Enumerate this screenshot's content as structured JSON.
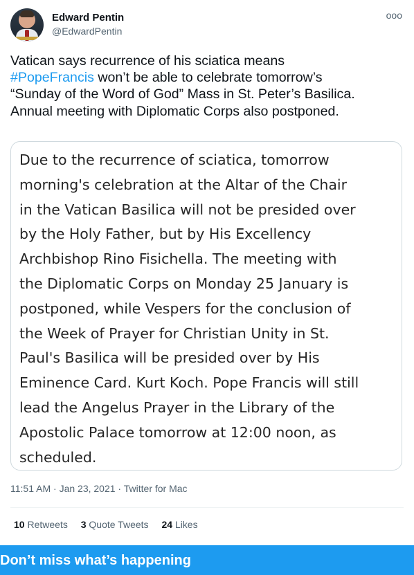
{
  "author": {
    "name": "Edward Pentin",
    "handle": "@EdwardPentin",
    "avatar_icon": "profile-photo"
  },
  "more_menu": {
    "icon": "more-icon",
    "glyph": "ooo"
  },
  "tweet": {
    "text_line1": "Vatican says recurrence of his sciatica means",
    "hashtag": "#PopeFrancis",
    "text_line2_rest": " won’t be able to celebrate tomorrow’s",
    "text_line3": "“Sunday of the Word of God” Mass in St. Peter’s Basilica.",
    "text_line4": "Annual meeting with Diplomatic Corps also postponed.",
    "hashtag_color": "#1d9bf0"
  },
  "media": {
    "lines": [
      "Due to the recurrence of sciatica, tomorrow",
      "morning's celebration at the Altar of the Chair",
      "in the Vatican Basilica will not be presided over",
      "by the Holy Father, but by His Excellency",
      "Archbishop Rino Fisichella. The meeting with",
      "the Diplomatic Corps on Monday 25 January is",
      "postponed, while Vespers for the conclusion of",
      "the Week of Prayer for Christian Unity in St.",
      "Paul's Basilica will be presided over by His",
      "Eminence Card. Kurt Koch. Pope Francis will still",
      "lead the Angelus Prayer in the Library of the",
      "Apostolic Palace tomorrow at 12:00 noon, as",
      "scheduled."
    ]
  },
  "meta": {
    "time": "11:51 AM",
    "date": "Jan 23, 2021",
    "source": "Twitter for Mac",
    "separator": " · "
  },
  "stats": {
    "retweets_count": "10",
    "retweets_label": "Retweets",
    "quote_count": "3",
    "quote_label": "Quote Tweets",
    "likes_count": "24",
    "likes_label": "Likes"
  },
  "bottom_banner": {
    "text": "Don’t miss what’s happening",
    "color": "#1d9bf0"
  }
}
